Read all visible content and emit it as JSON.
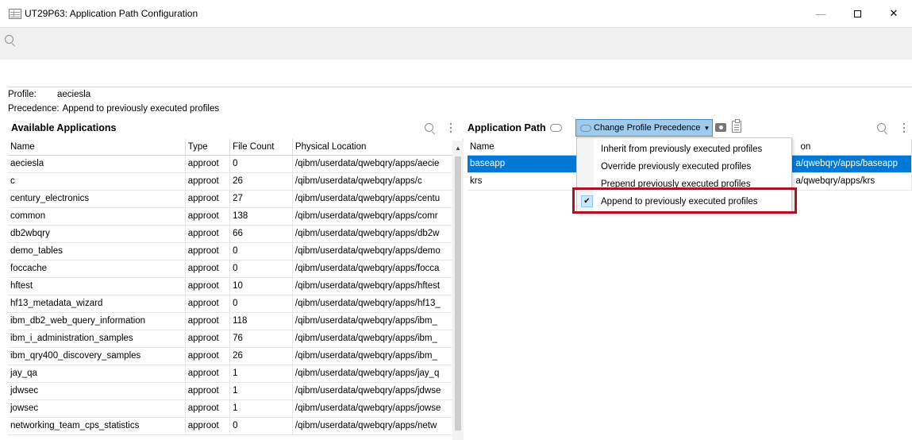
{
  "window": {
    "title": "UT29P63: Application Path Configuration",
    "controls": {
      "minimize": "—",
      "maximize": "☐",
      "close": "✕"
    }
  },
  "profile": {
    "profile_label": "Profile:",
    "profile_value": "aeciesla",
    "precedence_label": "Precedence:",
    "precedence_value": "Append to previously executed profiles"
  },
  "available_applications": {
    "title": "Available Applications",
    "columns": [
      "Name",
      "Type",
      "File Count",
      "Physical Location"
    ],
    "rows": [
      [
        "aeciesla",
        "approot",
        "0",
        "/qibm/userdata/qwebqry/apps/aecie"
      ],
      [
        "c",
        "approot",
        "26",
        "/qibm/userdata/qwebqry/apps/c"
      ],
      [
        "century_electronics",
        "approot",
        "27",
        "/qibm/userdata/qwebqry/apps/centu"
      ],
      [
        "common",
        "approot",
        "138",
        "/qibm/userdata/qwebqry/apps/comr"
      ],
      [
        "db2wbqry",
        "approot",
        "66",
        "/qibm/userdata/qwebqry/apps/db2w"
      ],
      [
        "demo_tables",
        "approot",
        "0",
        "/qibm/userdata/qwebqry/apps/demo"
      ],
      [
        "foccache",
        "approot",
        "0",
        "/qibm/userdata/qwebqry/apps/focca"
      ],
      [
        "hftest",
        "approot",
        "10",
        "/qibm/userdata/qwebqry/apps/hftest"
      ],
      [
        "hf13_metadata_wizard",
        "approot",
        "0",
        "/qibm/userdata/qwebqry/apps/hf13_"
      ],
      [
        "ibm_db2_web_query_information",
        "approot",
        "118",
        "/qibm/userdata/qwebqry/apps/ibm_"
      ],
      [
        "ibm_i_administration_samples",
        "approot",
        "76",
        "/qibm/userdata/qwebqry/apps/ibm_"
      ],
      [
        "ibm_qry400_discovery_samples",
        "approot",
        "26",
        "/qibm/userdata/qwebqry/apps/ibm_"
      ],
      [
        "jay_qa",
        "approot",
        "1",
        "/qibm/userdata/qwebqry/apps/jay_q"
      ],
      [
        "jdwsec",
        "approot",
        "1",
        "/qibm/userdata/qwebqry/apps/jdwse"
      ],
      [
        "jowsec",
        "approot",
        "1",
        "/qibm/userdata/qwebqry/apps/jowse"
      ],
      [
        "networking_team_cps_statistics",
        "approot",
        "0",
        "/qibm/userdata/qwebqry/apps/netw"
      ]
    ]
  },
  "application_path": {
    "title": "Application Path",
    "change_button": "Change Profile Precedence",
    "columns": [
      "Name",
      "on"
    ],
    "rows": [
      [
        "baseapp",
        "a/qwebqry/apps/baseapp"
      ],
      [
        "krs",
        "a/qwebqry/apps/krs"
      ]
    ]
  },
  "precedence_menu": {
    "items": [
      "Inherit from previously executed profiles",
      "Override previously executed profiles",
      "Prepend previously executed profiles",
      "Append to previously executed profiles"
    ],
    "checked_index": 3,
    "check_mark": "✔"
  },
  "colors": {
    "selection": "#0078d7",
    "highlight_border": "#b01020",
    "button_bg": "#9ecbee"
  }
}
